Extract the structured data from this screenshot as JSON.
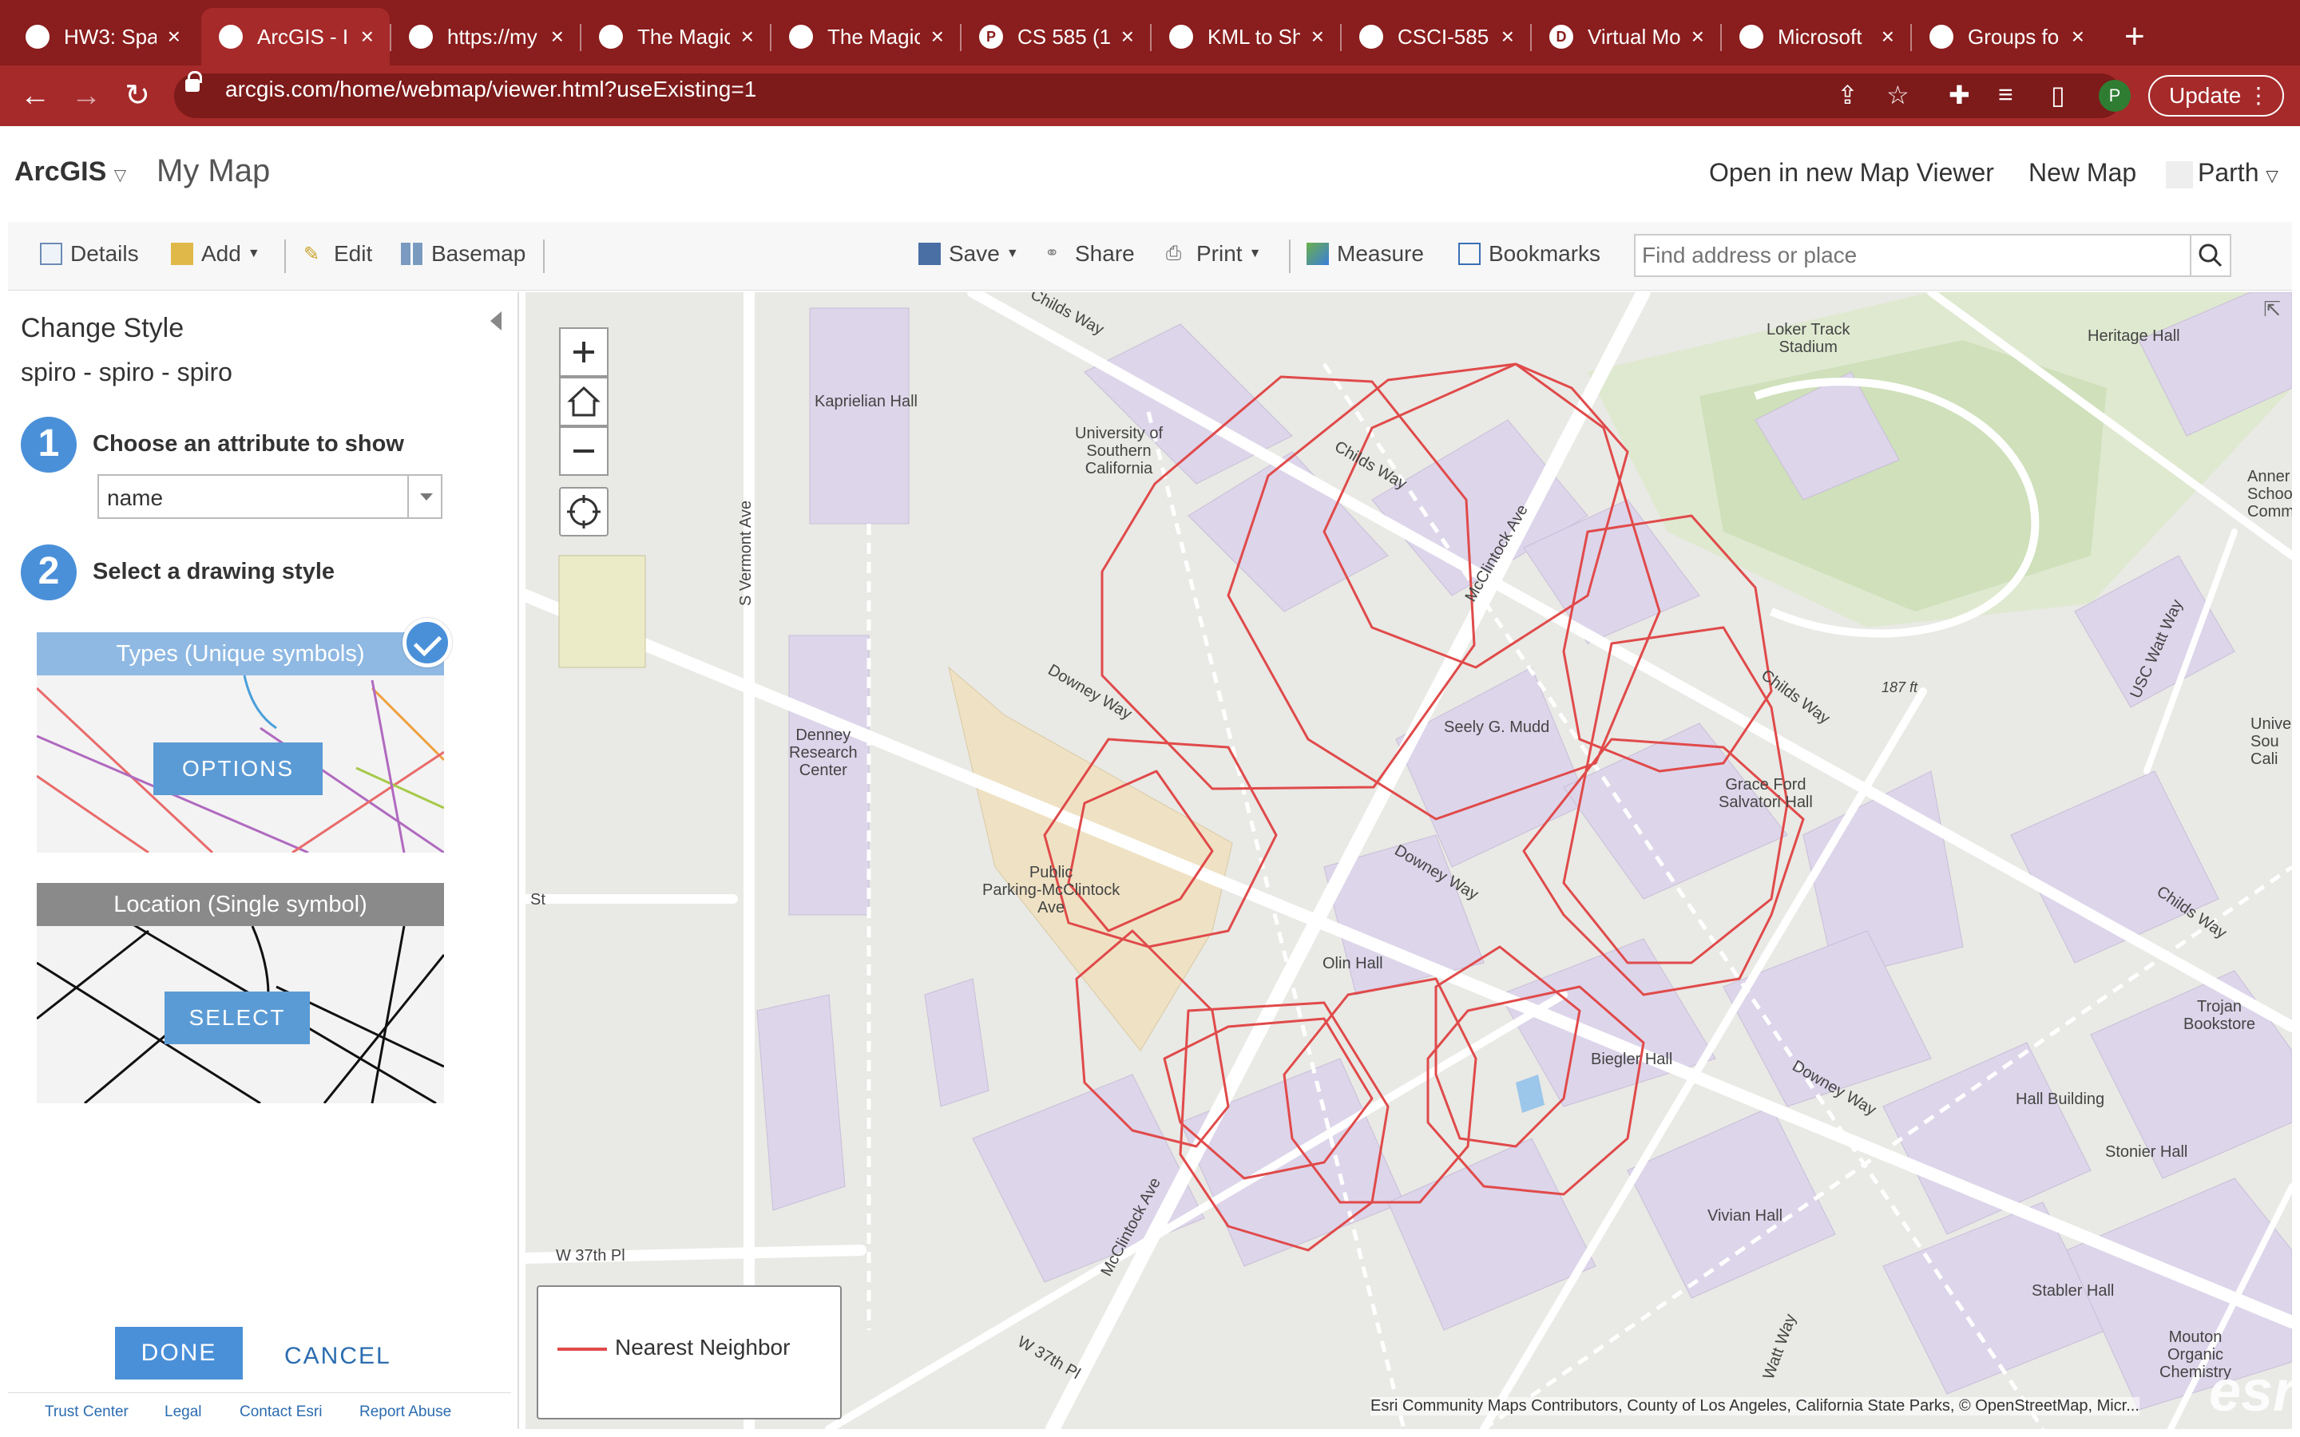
{
  "browser": {
    "tabs": [
      {
        "label": "HW3: Spa",
        "icon": "globe"
      },
      {
        "label": "ArcGIS - I",
        "icon": "arcgis"
      },
      {
        "label": "https://my",
        "icon": "check"
      },
      {
        "label": "The Magic",
        "icon": "globe"
      },
      {
        "label": "The Magic",
        "icon": "globe"
      },
      {
        "label": "CS 585 (1",
        "icon": "P"
      },
      {
        "label": "KML to Sh",
        "icon": "doc"
      },
      {
        "label": "CSCI-585",
        "icon": "github"
      },
      {
        "label": "Virtual Mo",
        "icon": "D2L"
      },
      {
        "label": "Microsoft",
        "icon": "globe"
      },
      {
        "label": "Groups fo",
        "icon": "doc"
      }
    ],
    "url": "arcgis.com/home/webmap/viewer.html?useExisting=1",
    "profile_initial": "P",
    "update_label": "Update"
  },
  "header": {
    "brand": "ArcGIS",
    "map_title": "My Map",
    "open_new_viewer": "Open in new Map Viewer",
    "new_map": "New Map",
    "user": "Parth"
  },
  "toolbar": {
    "details": "Details",
    "add": "Add",
    "edit": "Edit",
    "basemap": "Basemap",
    "save": "Save",
    "share": "Share",
    "print": "Print",
    "measure": "Measure",
    "bookmarks": "Bookmarks",
    "search_placeholder": "Find address or place"
  },
  "panel": {
    "title": "Change Style",
    "subtitle": "spiro - spiro - spiro",
    "step1_num": "1",
    "step1_label": "Choose an attribute to show",
    "attribute_value": "name",
    "step2_num": "2",
    "step2_label": "Select a drawing style",
    "card1_title": "Types (Unique symbols)",
    "card1_button": "OPTIONS",
    "card2_title": "Location (Single symbol)",
    "card2_button": "SELECT",
    "done": "DONE",
    "cancel": "CANCEL",
    "footer_links": [
      "Trust Center",
      "Legal",
      "Contact Esri",
      "Report Abuse"
    ]
  },
  "map": {
    "labels": {
      "kaprielian": "Kaprielian Hall",
      "usc": "University of\nSouthern\nCalifornia",
      "loker": "Loker Track\nStadium",
      "heritage": "Heritage Hall",
      "annenberg": "Anner\nSchoo\nCommu",
      "childs1": "Childs Way",
      "mcclintock1": "McClintock Ave",
      "downey1": "Downey Way",
      "denney": "Denney\nResearch\nCenter",
      "seely": "Seely G. Mudd",
      "childs2": "Childs Way",
      "elev": "187 ft",
      "uscwatt": "USC Watt Way",
      "univ": "Unive\nSou\nCali",
      "grace": "Grace Ford\nSalvatori Hall",
      "parking": "Public\nParking-McClintock\nAve",
      "downey2": "Downey Way",
      "childs3": "Childs Way",
      "olin": "Olin Hall",
      "trojan": "Trojan\nBookstore",
      "biegler": "Biegler Hall",
      "downey3": "Downey Way",
      "hallbldg": "Hall Building",
      "stonier": "Stonier Hall",
      "vivian": "Vivian Hall",
      "mcclintock2": "McClintock Ave",
      "stabler": "Stabler Hall",
      "w37": "W 37th Pl",
      "w37b": "W 37th Pl",
      "vermont": "S Vermont Ave",
      "st": "St",
      "wattway": "Watt Way",
      "mouton": "Mouton\nOrganic\nChemistry",
      "usway": "Childs Way"
    },
    "legend_label": "Nearest Neighbor",
    "line_color": "#e04a4a",
    "attribution": "Esri Community Maps Contributors, County of Los Angeles, California State Parks, © OpenStreetMap, Micr...",
    "logo": "esri"
  }
}
